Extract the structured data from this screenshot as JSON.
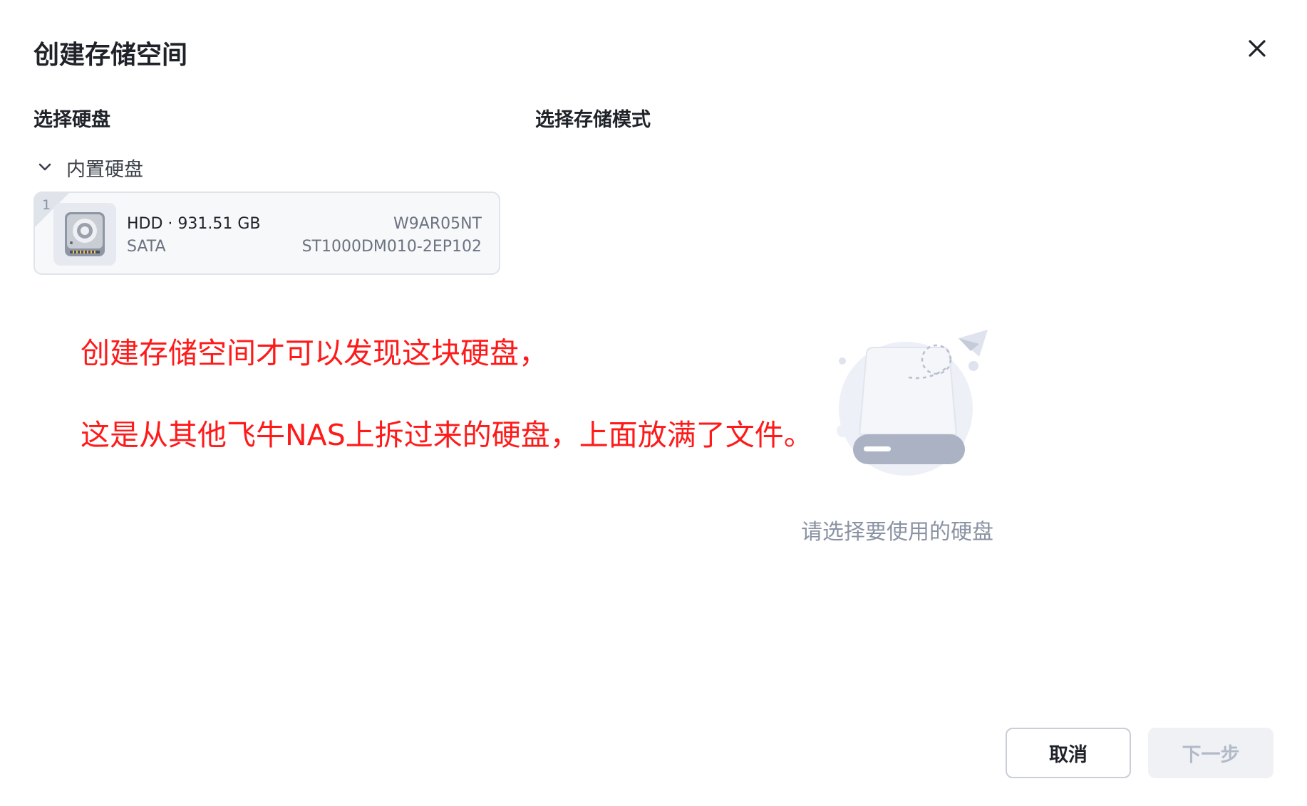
{
  "dialog": {
    "title": "创建存储空间",
    "close_icon": "close-icon"
  },
  "sections": {
    "select_disk": "选择硬盘",
    "select_mode": "选择存储模式"
  },
  "disk_group": {
    "label": "内置硬盘",
    "expanded": true,
    "icon": "chevron-down-icon"
  },
  "disks": [
    {
      "index": "1",
      "icon": "hard-disk-icon",
      "type_size": "HDD · 931.51 GB",
      "interface": "SATA",
      "serial": "W9AR05NT",
      "model": "ST1000DM010-2EP102"
    }
  ],
  "annotations": {
    "line1": "创建存储空间才可以发现这块硬盘，",
    "line2": "这是从其他飞牛NAS上拆过来的硬盘，上面放满了文件。",
    "color": "#ff1a1a"
  },
  "empty_state": {
    "icon": "empty-disk-illustration",
    "text": "请选择要使用的硬盘"
  },
  "footer": {
    "cancel_label": "取消",
    "next_label": "下一步",
    "next_disabled": true
  }
}
